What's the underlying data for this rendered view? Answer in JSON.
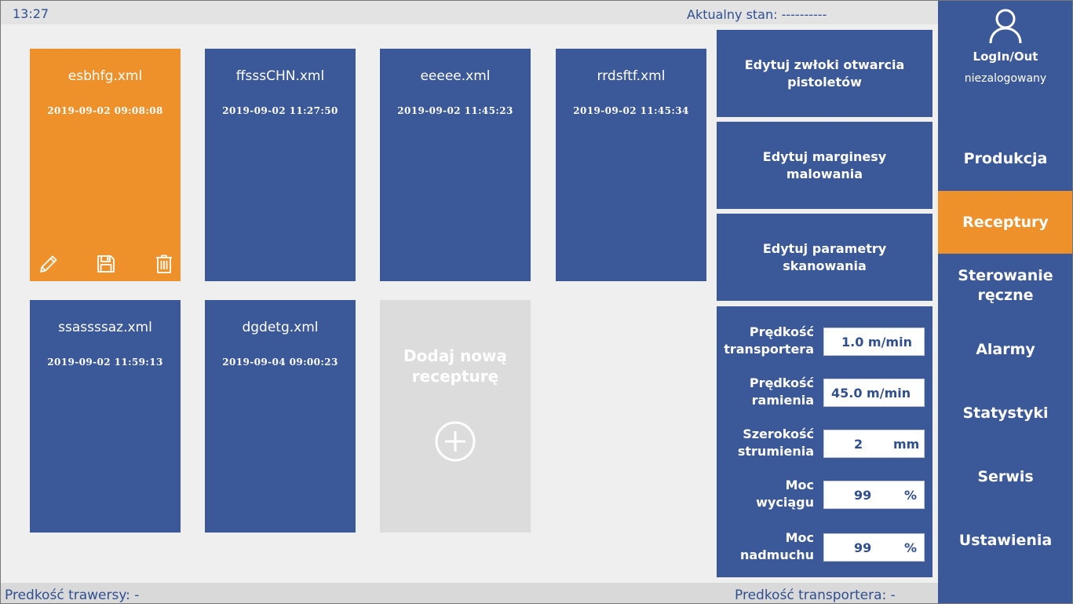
{
  "topbar": {
    "time": "13:27",
    "status": "Aktualny stan: ----------"
  },
  "bottombar": {
    "left": "Predkość trawersy:  -",
    "right": "Predkość transportera:  -"
  },
  "recipes": [
    {
      "name": "esbhfg.xml",
      "date": "2019-09-02 09:08:08",
      "selected": true
    },
    {
      "name": "ffsssCHN.xml",
      "date": "2019-09-02 11:27:50",
      "selected": false
    },
    {
      "name": "eeeee.xml",
      "date": "2019-09-02 11:45:23",
      "selected": false
    },
    {
      "name": "rrdsftf.xml",
      "date": "2019-09-02 11:45:34",
      "selected": false
    },
    {
      "name": "ssassssaz.xml",
      "date": "2019-09-02 11:59:13",
      "selected": false
    },
    {
      "name": "dgdetg.xml",
      "date": "2019-09-04 09:00:23",
      "selected": false
    }
  ],
  "card_actions": {
    "edit_icon": "pencil-icon",
    "save_icon": "floppy-disk-icon",
    "delete_icon": "trash-icon"
  },
  "add_recipe": {
    "line1": "Dodaj nową",
    "line2": "recepturę",
    "icon": "plus-circle-icon"
  },
  "edit_buttons": [
    {
      "line1": "Edytuj zwłoki otwarcia",
      "line2": "pistoletów"
    },
    {
      "line1": "Edytuj marginesy",
      "line2": "malowania"
    },
    {
      "line1": "Edytuj parametry",
      "line2": "skanowania"
    }
  ],
  "params": [
    {
      "line1": "Prędkość",
      "line2": "transportera",
      "value": "1.0 m/min",
      "unit": ""
    },
    {
      "line1": "Prędkość",
      "line2": "ramienia",
      "value": "45.0 m/min",
      "unit": ""
    },
    {
      "line1": "Szerokość",
      "line2": "strumienia",
      "value": "2",
      "unit": "mm"
    },
    {
      "line1": "Moc",
      "line2": "wyciągu",
      "value": "99",
      "unit": "%"
    },
    {
      "line1": "Moc",
      "line2": "nadmuchu",
      "value": "99",
      "unit": "%"
    }
  ],
  "sidebar": {
    "user_icon": "user-icon",
    "login_label": "LogIn/Out",
    "login_status": "niezalogowany",
    "nav": [
      {
        "label": "Produkcja",
        "active": false
      },
      {
        "label": "Receptury",
        "active": true
      },
      {
        "label": "Sterowanie ręczne",
        "active": false
      },
      {
        "label": "Alarmy",
        "active": false
      },
      {
        "label": "Statystyki",
        "active": false
      },
      {
        "label": "Serwis",
        "active": false
      },
      {
        "label": "Ustawienia",
        "active": false
      }
    ]
  },
  "colors": {
    "primary": "#3b5998",
    "accent": "#ee912a",
    "background": "#efefef",
    "disabled_card": "#dcdcdc"
  }
}
